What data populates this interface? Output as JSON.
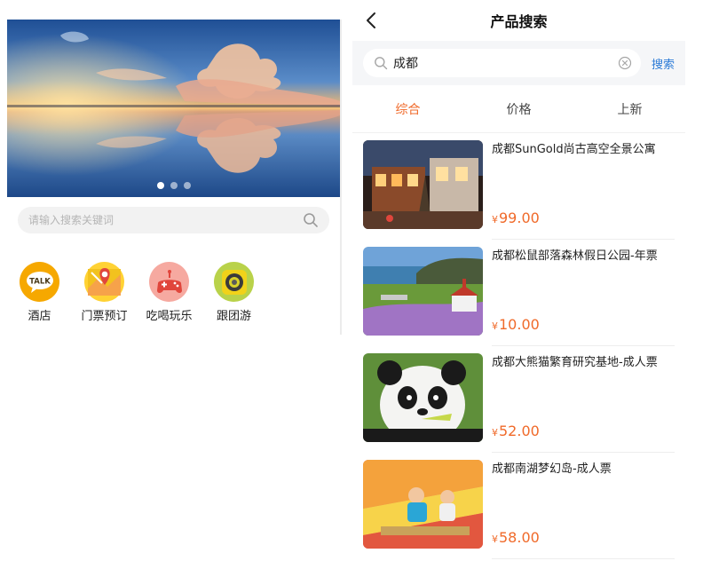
{
  "left_page": {
    "banner": {
      "dots": 3,
      "active_dot": 0
    },
    "search": {
      "placeholder": "请输入搜索关键词"
    },
    "categories": [
      {
        "label": "酒店",
        "icon": "talk-bubble-icon",
        "color": "#f6a800"
      },
      {
        "label": "门票预订",
        "icon": "map-pin-icon",
        "color": "#ffd234"
      },
      {
        "label": "吃喝玩乐",
        "icon": "gamepad-icon",
        "color": "#f6a9a0"
      },
      {
        "label": "跟团游",
        "icon": "camera-lens-icon",
        "color": "#b9d24a"
      }
    ]
  },
  "right_page": {
    "title": "产品搜索",
    "search": {
      "value": "成都",
      "button": "搜索"
    },
    "tabs": [
      {
        "label": "综合",
        "active": true
      },
      {
        "label": "价格",
        "active": false
      },
      {
        "label": "上新",
        "active": false
      }
    ],
    "products": [
      {
        "name": "成都SunGold尚古高空全景公寓",
        "currency": "¥",
        "price": "99.00"
      },
      {
        "name": "成都松鼠部落森林假日公园-年票",
        "currency": "¥",
        "price": "10.00"
      },
      {
        "name": "成都大熊猫繁育研究基地-成人票",
        "currency": "¥",
        "price": "52.00"
      },
      {
        "name": "成都南湖梦幻岛-成人票",
        "currency": "¥",
        "price": "58.00"
      }
    ]
  },
  "colors": {
    "accent": "#f06a2a",
    "link": "#2a7ad6"
  }
}
